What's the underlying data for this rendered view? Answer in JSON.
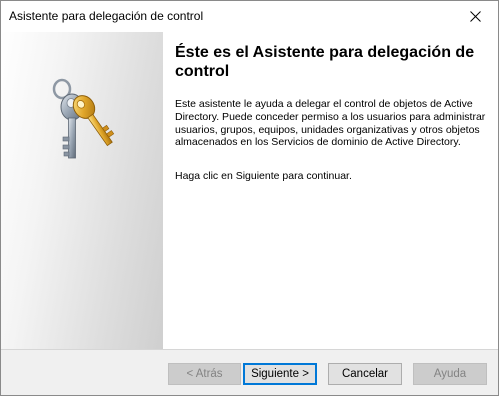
{
  "window": {
    "title": "Asistente para delegación de control"
  },
  "side_panel": {
    "icon": "keys-icon"
  },
  "content": {
    "heading": "Éste es el Asistente para delegación de control",
    "description": "Este asistente le ayuda a delegar el control de objetos de Active Directory. Puede conceder permiso a los usuarios para administrar usuarios, grupos, equipos, unidades organizativas y otros objetos almacenados en los Servicios de dominio de Active Directory.",
    "instruction": "Haga clic en Siguiente para continuar."
  },
  "buttons": {
    "back": "< Atrás",
    "next": "Siguiente >",
    "cancel": "Cancelar",
    "help": "Ayuda"
  },
  "colors": {
    "key_silver": "#9aa6b4",
    "key_gold": "#e0a62a",
    "focus_blue": "#0078d7"
  }
}
